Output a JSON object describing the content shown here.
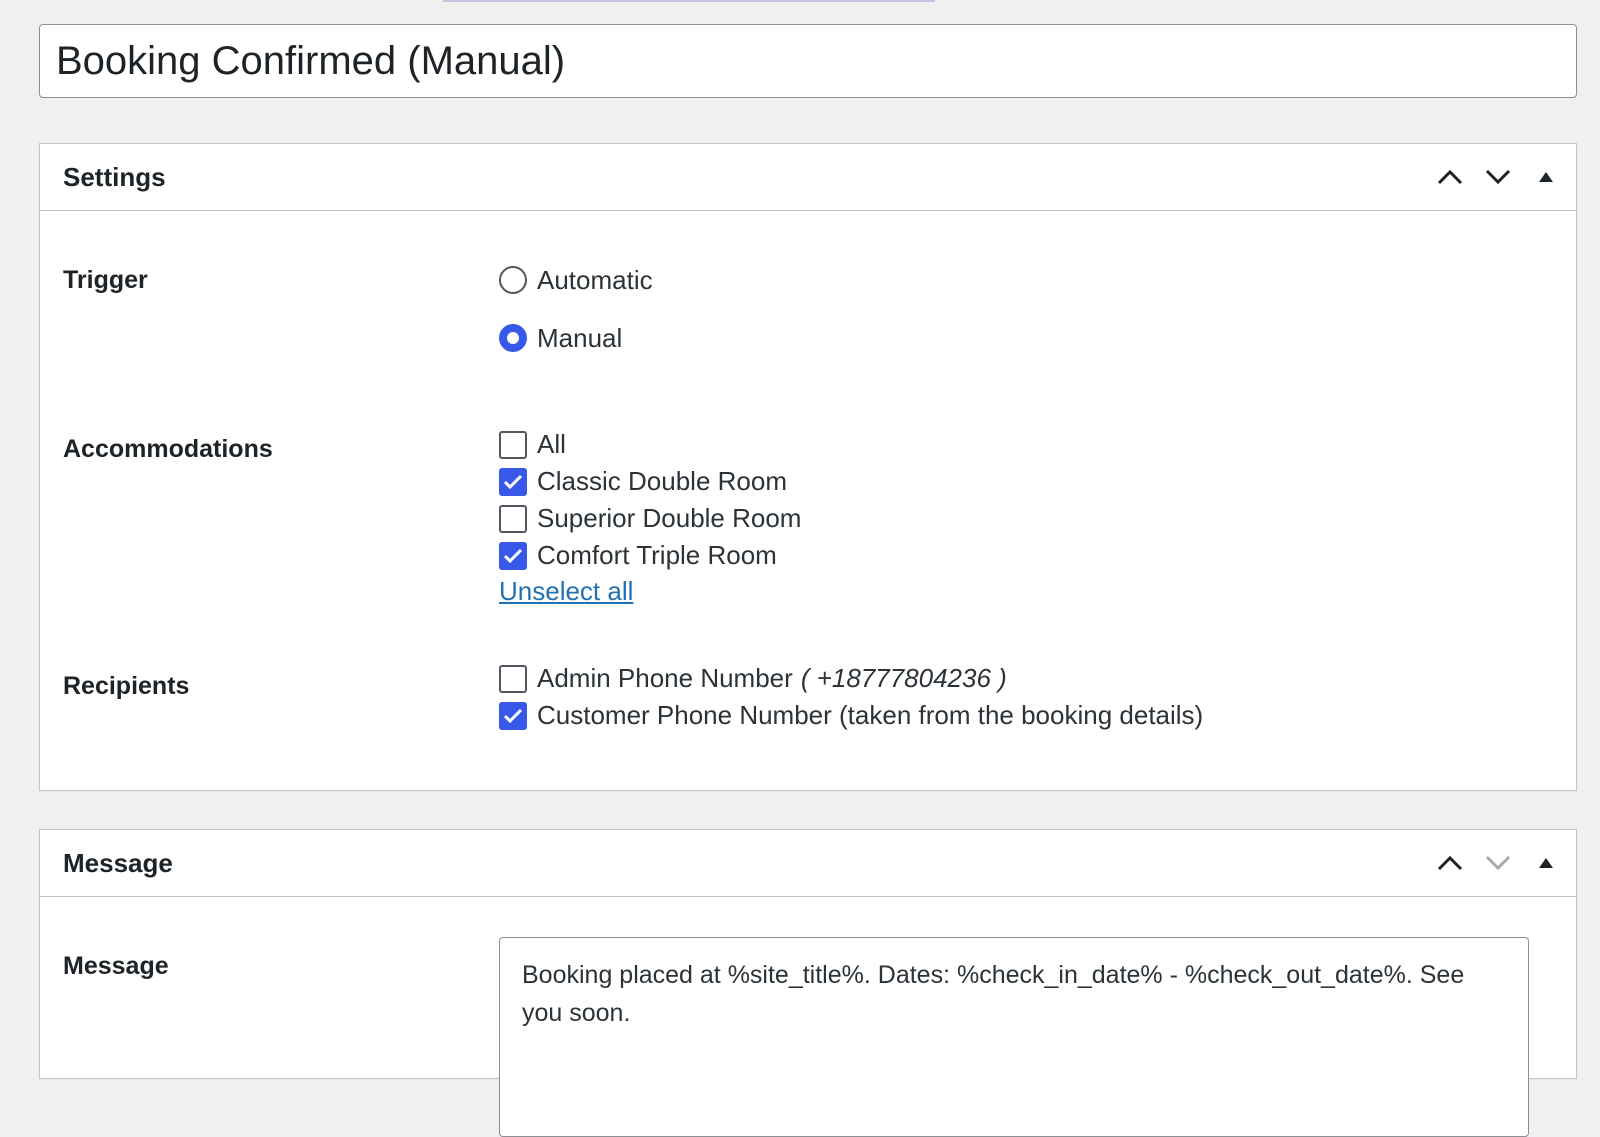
{
  "post_title": "Booking Confirmed (Manual)",
  "colors": {
    "accent": "#3858e9",
    "link": "#2271b1",
    "border": "#c3c4c7",
    "background": "#f0f0f1"
  },
  "settings_box": {
    "title": "Settings",
    "icons": [
      "chevron-up-icon",
      "chevron-down-icon",
      "toggle-arrow-icon"
    ],
    "trigger": {
      "label": "Trigger",
      "options": [
        {
          "label": "Automatic",
          "checked": false
        },
        {
          "label": "Manual",
          "checked": true
        }
      ]
    },
    "accommodations": {
      "label": "Accommodations",
      "options": [
        {
          "label": "All",
          "checked": false
        },
        {
          "label": "Classic Double Room",
          "checked": true
        },
        {
          "label": "Superior Double Room",
          "checked": false
        },
        {
          "label": "Comfort Triple Room",
          "checked": true
        }
      ],
      "unselect_all": "Unselect all"
    },
    "recipients": {
      "label": "Recipients",
      "options": [
        {
          "label": "Admin Phone Number",
          "note": "( +18777804236 )",
          "checked": false
        },
        {
          "label": "Customer Phone Number (taken from the booking details)",
          "checked": true
        }
      ]
    }
  },
  "message_box": {
    "title": "Message",
    "icons": [
      "chevron-up-icon",
      "chevron-down-icon",
      "toggle-arrow-icon"
    ],
    "field_label": "Message",
    "message_text": "Booking placed at %site_title%. Dates: %check_in_date% - %check_out_date%. See you soon."
  }
}
